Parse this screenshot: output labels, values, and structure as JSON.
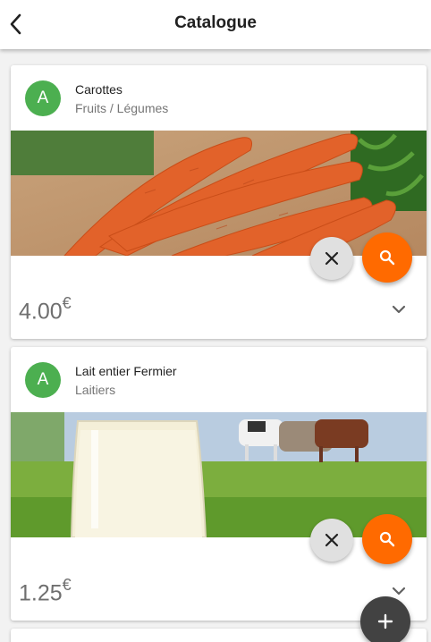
{
  "appbar": {
    "title": "Catalogue",
    "back_icon": "arrow-left-icon"
  },
  "products": [
    {
      "avatar": "A",
      "name": "Carottes",
      "category": "Fruits / Légumes",
      "price": "4.00",
      "currency": "€",
      "image": "carrots"
    },
    {
      "avatar": "A",
      "name": "Lait entier Fermier",
      "category": "Laitiers",
      "price": "1.25",
      "currency": "€",
      "image": "milk"
    }
  ],
  "colors": {
    "avatar": "#4caf50",
    "search_fab": "#ff6a00",
    "add_fab": "#424242",
    "close_fab": "#e0e0e0"
  },
  "icons": {
    "close": "close-icon",
    "search": "search-icon",
    "expand": "chevron-down-icon",
    "add": "plus-icon"
  }
}
